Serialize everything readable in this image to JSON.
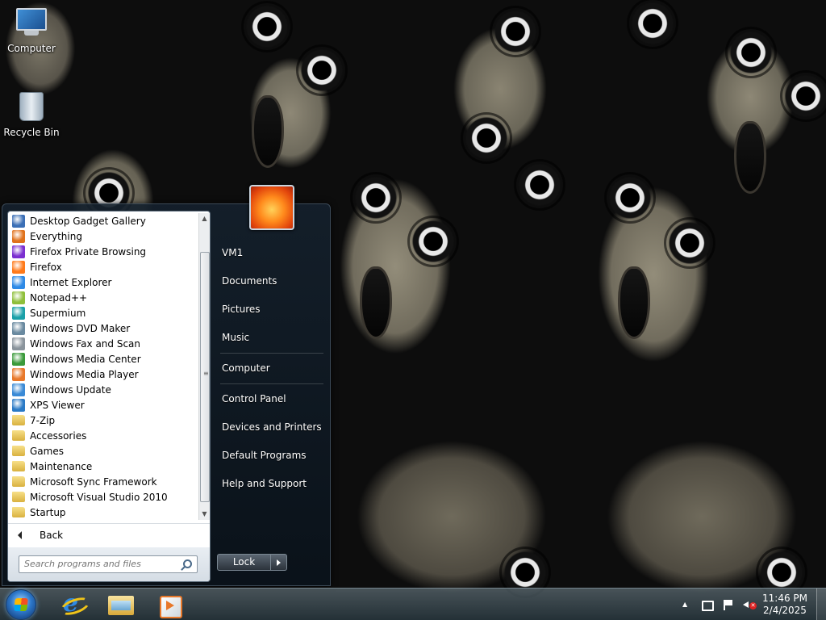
{
  "desktop": {
    "icons": [
      {
        "label": "Computer",
        "icon": "computer-icon"
      },
      {
        "label": "Recycle Bin",
        "icon": "recycle-bin-icon"
      }
    ]
  },
  "start_menu": {
    "programs": [
      {
        "label": "Desktop Gadget Gallery",
        "icon": "gadget-icon",
        "color": "#3b6fb6"
      },
      {
        "label": "Everything",
        "icon": "magnifier-icon",
        "color": "#e0721c"
      },
      {
        "label": "Firefox Private Browsing",
        "icon": "firefox-private-icon",
        "color": "#7b2fd0"
      },
      {
        "label": "Firefox",
        "icon": "firefox-icon",
        "color": "#ff7a1a"
      },
      {
        "label": "Internet Explorer",
        "icon": "ie-icon",
        "color": "#2e8ae6"
      },
      {
        "label": "Notepad++",
        "icon": "notepadpp-icon",
        "color": "#8fbf3a"
      },
      {
        "label": "Supermium",
        "icon": "supermium-icon",
        "color": "#1aa0a8"
      },
      {
        "label": "Windows DVD Maker",
        "icon": "dvd-maker-icon",
        "color": "#6a8aa0"
      },
      {
        "label": "Windows Fax and Scan",
        "icon": "fax-icon",
        "color": "#8a949c"
      },
      {
        "label": "Windows Media Center",
        "icon": "media-center-icon",
        "color": "#3a9a3a"
      },
      {
        "label": "Windows Media Player",
        "icon": "media-player-icon",
        "color": "#e8782a"
      },
      {
        "label": "Windows Update",
        "icon": "windows-update-icon",
        "color": "#3a8ad6"
      },
      {
        "label": "XPS Viewer",
        "icon": "xps-viewer-icon",
        "color": "#2a7ac6"
      },
      {
        "label": "7-Zip",
        "icon": "folder-icon",
        "color": "folder"
      },
      {
        "label": "Accessories",
        "icon": "folder-icon",
        "color": "folder"
      },
      {
        "label": "Games",
        "icon": "folder-icon",
        "color": "folder"
      },
      {
        "label": "Maintenance",
        "icon": "folder-icon",
        "color": "folder"
      },
      {
        "label": "Microsoft Sync Framework",
        "icon": "folder-icon",
        "color": "folder"
      },
      {
        "label": "Microsoft Visual Studio 2010",
        "icon": "folder-icon",
        "color": "folder"
      },
      {
        "label": "Startup",
        "icon": "folder-icon",
        "color": "folder"
      }
    ],
    "back_label": "Back",
    "search_placeholder": "Search programs and files",
    "right_items": [
      {
        "label": "VM1",
        "name": "user-folder-link"
      },
      {
        "label": "Documents",
        "name": "documents-link"
      },
      {
        "label": "Pictures",
        "name": "pictures-link"
      },
      {
        "label": "Music",
        "name": "music-link"
      },
      {
        "label": "Computer",
        "name": "computer-link"
      },
      {
        "label": "Control Panel",
        "name": "control-panel-link"
      },
      {
        "label": "Devices and Printers",
        "name": "devices-printers-link"
      },
      {
        "label": "Default Programs",
        "name": "default-programs-link"
      },
      {
        "label": "Help and Support",
        "name": "help-support-link"
      }
    ],
    "lock_label": "Lock"
  },
  "taskbar": {
    "pinned": [
      {
        "name": "internet-explorer",
        "icon": "ie-icon"
      },
      {
        "name": "windows-explorer",
        "icon": "folder-explorer-icon"
      },
      {
        "name": "windows-media-player",
        "icon": "media-player-icon"
      }
    ],
    "clock": {
      "time": "11:46 PM",
      "date": "2/4/2025"
    }
  }
}
